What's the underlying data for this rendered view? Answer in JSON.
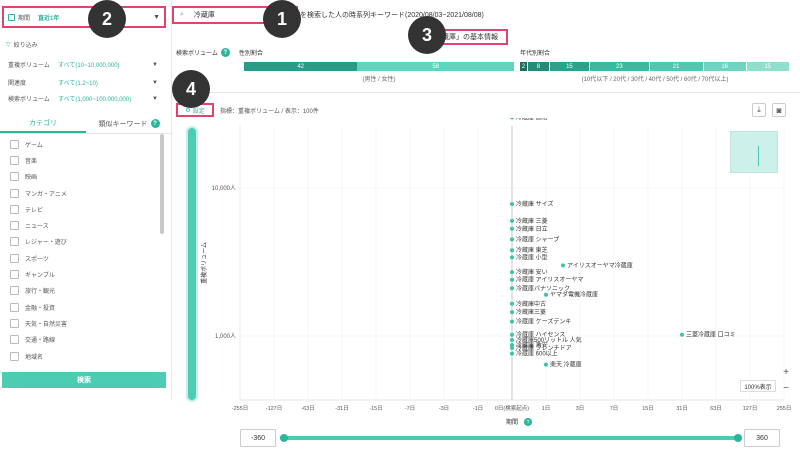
{
  "sidebar": {
    "period_label": "期間",
    "period_value": "直近1年",
    "filter_title": "絞り込み",
    "filters": [
      {
        "label": "重複ボリューム",
        "value": "すべて(10~10,000,000)"
      },
      {
        "label": "関連度",
        "value": "すべて(1.2~10)"
      },
      {
        "label": "検索ボリューム",
        "value": "すべて(1,000~100,000,000)"
      }
    ],
    "tab_category": "カテゴリ",
    "tab_similar": "類似キーワード",
    "categories": [
      "ゲーム",
      "音楽",
      "映画",
      "マンガ・アニメ",
      "テレビ",
      "ニュース",
      "レジャー・遊び",
      "スポーツ",
      "ギャンブル",
      "旅行・観光",
      "金融・投資",
      "天気・自然災害",
      "交通・路線",
      "地域名"
    ],
    "search_button": "検索"
  },
  "badges": [
    "1",
    "2",
    "3",
    "4"
  ],
  "header": {
    "keyword": "冷蔵庫",
    "headline": "を検索した人の時系列キーワード(2020/08/03~2021/08/08)",
    "info_title": "「冷蔵庫」の基本情報",
    "volume_label": "検索ボリューム",
    "gender_label": "性別割合",
    "gender_values": [
      "42",
      "58"
    ],
    "gender_caption": "(男性 / 女性)",
    "age_label": "年代別割合",
    "age_values": [
      "2",
      "8",
      "15",
      "23",
      "21",
      "16",
      "15"
    ],
    "age_caption": "(10代以下 / 20代 / 30代 / 40代 / 50代 / 60代 / 70代以上)"
  },
  "toolbar": {
    "settings": "設定",
    "metric": "指標：重複ボリューム / 表示：100件",
    "zoom_label": "100%表示",
    "zoom_in": "+",
    "zoom_out": "−"
  },
  "slider": {
    "min": "-360",
    "max": "360"
  },
  "chart_data": {
    "type": "scatter",
    "xlabel": "期間",
    "ylabel": "重複ボリューム",
    "yscale": "log",
    "x_ticks": [
      "-255日",
      "-127日",
      "-63日",
      "-31日",
      "-15日",
      "-7日",
      "-3日",
      "-1日",
      "0日(検索起点)",
      "1日",
      "3日",
      "7日",
      "15日",
      "31日",
      "63日",
      "127日",
      "255日"
    ],
    "y_ticks": [
      "10,000人",
      "1,000人"
    ],
    "points": [
      {
        "label": "冷蔵庫 価格",
        "x": 0,
        "y": 30000
      },
      {
        "label": "冷蔵庫 サイズ",
        "x": 0,
        "y": 7800
      },
      {
        "label": "冷蔵庫 三菱",
        "x": 0,
        "y": 6000
      },
      {
        "label": "冷蔵庫 日立",
        "x": 0,
        "y": 5300
      },
      {
        "label": "冷蔵庫 シャープ",
        "x": 0,
        "y": 4500
      },
      {
        "label": "冷蔵庫 東芝",
        "x": 0,
        "y": 3800
      },
      {
        "label": "冷蔵庫 小型",
        "x": 0,
        "y": 3400
      },
      {
        "label": "アイリスオーヤマ冷蔵庫",
        "x": 2,
        "y": 3000
      },
      {
        "label": "冷蔵庫 安い",
        "x": 0,
        "y": 2700
      },
      {
        "label": "冷蔵庫 アイリスオーヤマ",
        "x": 0,
        "y": 2400
      },
      {
        "label": "冷蔵庫パナソニック",
        "x": 0,
        "y": 2100
      },
      {
        "label": "ヤマダ電機冷蔵庫",
        "x": 1,
        "y": 1900
      },
      {
        "label": "冷蔵庫中古",
        "x": 0,
        "y": 1650
      },
      {
        "label": "冷蔵庫三菱",
        "x": 0,
        "y": 1450
      },
      {
        "label": "冷蔵庫 ケーズデンキ",
        "x": 0,
        "y": 1250
      },
      {
        "label": "冷蔵庫 ハイセンス",
        "x": 0,
        "y": 1020
      },
      {
        "label": "三菱冷蔵庫 口コミ",
        "x": 31,
        "y": 1020
      },
      {
        "label": "冷蔵庫500リットル 人気",
        "x": 0,
        "y": 940
      },
      {
        "label": "冷蔵庫 激安",
        "x": 0,
        "y": 870
      },
      {
        "label": "冷蔵庫 フレンチドア",
        "x": 0,
        "y": 830
      },
      {
        "label": "冷蔵庫 600以上",
        "x": 0,
        "y": 760
      },
      {
        "label": "楽天 冷蔵庫",
        "x": 1,
        "y": 640
      }
    ]
  }
}
